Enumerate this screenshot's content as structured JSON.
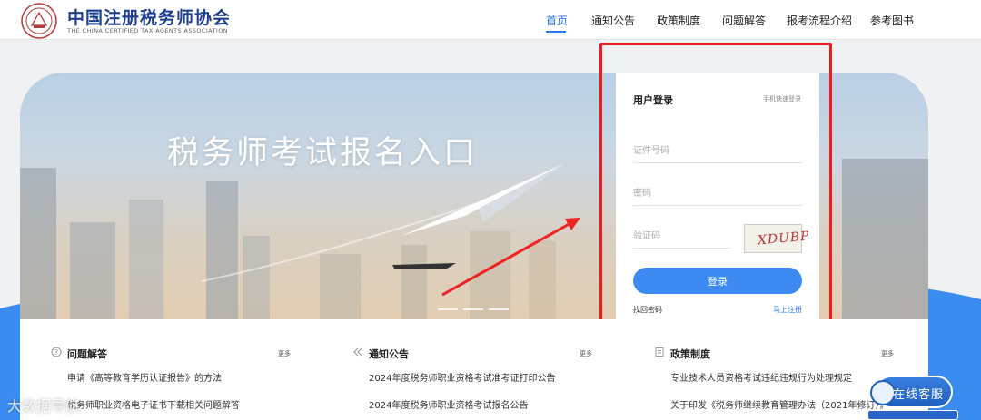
{
  "header": {
    "title": "中国注册税务师协会",
    "subtitle": "THE CHINA CERTIFIED TAX AGENTS ASSOCIATION"
  },
  "nav": {
    "items": [
      {
        "label": "首页",
        "active": true
      },
      {
        "label": "通知公告",
        "active": false
      },
      {
        "label": "政策制度",
        "active": false
      },
      {
        "label": "问题解答",
        "active": false
      },
      {
        "label": "报考流程介绍",
        "active": false
      },
      {
        "label": "参考图书",
        "active": false
      }
    ]
  },
  "banner": {
    "title": "税务师考试报名入口"
  },
  "login": {
    "title": "用户登录",
    "quick_login": "手机快速登录",
    "id_placeholder": "证件号码",
    "password_placeholder": "密码",
    "captcha_placeholder": "验证码",
    "captcha_text": "XDUBP",
    "submit": "登录",
    "forgot": "找回密码",
    "register": "马上注册"
  },
  "sections": [
    {
      "title": "问题解答",
      "more": "更多",
      "icon": "question-circle-icon",
      "items": [
        "申请《高等教育学历认证报告》的方法",
        "税务师职业资格电子证书下载相关问题解答"
      ]
    },
    {
      "title": "通知公告",
      "more": "更多",
      "icon": "double-chevron-left-icon",
      "items": [
        "2024年度税务师职业资格考试准考证打印公告",
        "2024年度税务师职业资格考试报名公告"
      ]
    },
    {
      "title": "政策制度",
      "more": "更多",
      "icon": "document-icon",
      "items": [
        "专业技术人员资格考试违纪违规行为处理规定",
        "关于印发《税务师继续教育管理办法（2021年修订）》"
      ]
    }
  ],
  "service": {
    "label": "在线客服"
  },
  "watermark": "大数据导航",
  "colors": {
    "accent": "#2a77f0",
    "brand": "#1e3f8f",
    "highlight_box": "#ee1c1c",
    "button": "#3d8bf2"
  }
}
